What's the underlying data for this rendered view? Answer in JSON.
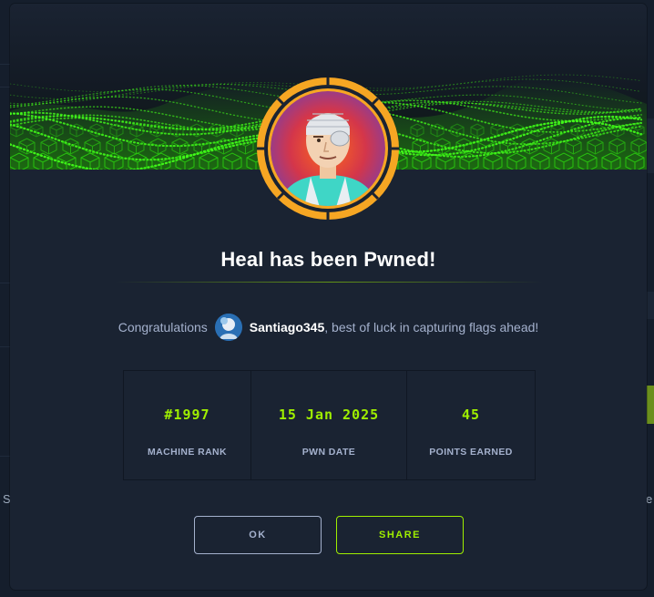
{
  "modal": {
    "title": "Heal has been Pwned!",
    "congrats_prefix": "Congratulations",
    "username": "Santiago345",
    "congrats_suffix": ", best of luck in capturing flags ahead!"
  },
  "stats": [
    {
      "value": "#1997",
      "label": "MACHINE RANK"
    },
    {
      "value": "15 Jan 2025",
      "label": "PWN DATE"
    },
    {
      "value": "45",
      "label": "POINTS EARNED"
    }
  ],
  "buttons": {
    "ok": "OK",
    "share": "SHARE"
  },
  "background": {
    "left_glyph": "S",
    "right_glyph": "e"
  },
  "colors": {
    "accent": "#9fef00",
    "modal_bg": "#1a2332",
    "text_muted": "#a4b1cd",
    "avatar_ring": "#f6a623"
  },
  "icons": {
    "banner": "green-cube-wave-banner",
    "machine_avatar": "bandaged-patient-avatar",
    "user_avatar": "user-avatar"
  }
}
